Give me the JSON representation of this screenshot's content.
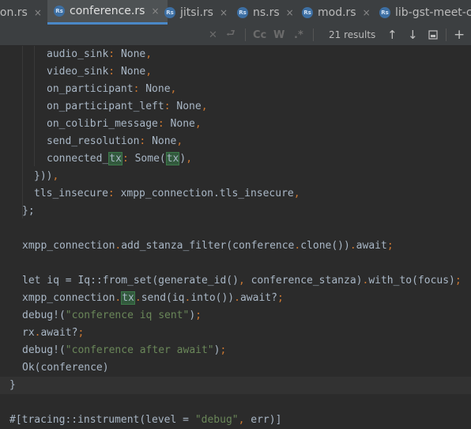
{
  "tabs": [
    {
      "label": "ion.rs",
      "has_icon": false,
      "active": false
    },
    {
      "label": "conference.rs",
      "has_icon": true,
      "active": true
    },
    {
      "label": "jitsi.rs",
      "has_icon": true,
      "active": false
    },
    {
      "label": "ns.rs",
      "has_icon": true,
      "active": false
    },
    {
      "label": "mod.rs",
      "has_icon": true,
      "active": false
    },
    {
      "label": "lib-gst-meet-c/",
      "has_icon": true,
      "active": false
    }
  ],
  "tab_icon_text": "Rs",
  "close_glyph": "×",
  "search": {
    "match_case": "Cc",
    "words": "W",
    "regex": ".*",
    "results": "21 results"
  },
  "code": {
    "l1_key": "audio_sink",
    "l1_val": "None",
    "l2_key": "video_sink",
    "l2_val": "None",
    "l3_key": "on_participant",
    "l3_val": "None",
    "l4_key": "on_participant_left",
    "l4_val": "None",
    "l5_key": "on_colibri_message",
    "l5_val": "None",
    "l6_key": "send_resolution",
    "l6_val": "None",
    "l7_key": "connected_",
    "l7_tx": "tx",
    "l7_some": "Some(",
    "l7_tx2": "tx",
    "l7_close": ")",
    "l8": "}))",
    "l9_key": "tls_insecure",
    "l9_val": "xmpp_connection.tls_insecure",
    "l10": "};",
    "l11_a": "xmpp_connection",
    "l11_b": "add_stanza_filter(conference",
    "l11_c": "clone())",
    "l11_d": "await",
    "l12_let": "let iq = Iq::from_set(generate_id()",
    "l12_b": " conference_stanza)",
    "l12_c": "with_to(focus)",
    "l13_a": "xmpp_connection",
    "l13_tx": "tx",
    "l13_b": "send(iq",
    "l13_c": "into())",
    "l13_d": "await?",
    "l14_mac": "debug!(",
    "l14_str": "\"conference iq sent\"",
    "l14_end": ")",
    "l15_a": "rx",
    "l15_b": "await?",
    "l16_mac": "debug!(",
    "l16_str": "\"conference after await\"",
    "l16_end": ")",
    "l17": "Ok(conference)",
    "l18": "}",
    "l19_a": "#[tracing::instrument(level = ",
    "l19_str": "\"debug\"",
    "l19_b": " err)]"
  }
}
